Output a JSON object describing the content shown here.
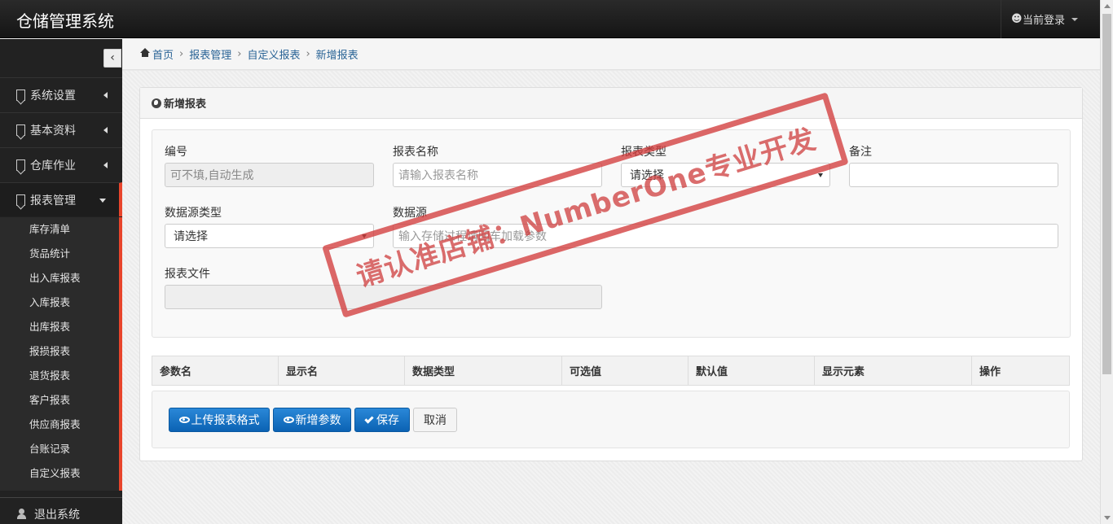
{
  "app": {
    "title": "仓储管理系统"
  },
  "user_menu": {
    "label": "当前登录"
  },
  "sidebar": {
    "collapse_icon": "chevron-left-icon",
    "items": [
      {
        "label": "系统设置"
      },
      {
        "label": "基本资料"
      },
      {
        "label": "仓库作业"
      },
      {
        "label": "报表管理"
      }
    ],
    "subitems": [
      {
        "label": "库存清单"
      },
      {
        "label": "货品统计"
      },
      {
        "label": "出入库报表"
      },
      {
        "label": "入库报表"
      },
      {
        "label": "出库报表"
      },
      {
        "label": "报损报表"
      },
      {
        "label": "退货报表"
      },
      {
        "label": "客户报表"
      },
      {
        "label": "供应商报表"
      },
      {
        "label": "台账记录"
      },
      {
        "label": "自定义报表"
      }
    ],
    "logout": {
      "label": "退出系统"
    }
  },
  "breadcrumb": {
    "home": "首页",
    "level1": "报表管理",
    "level2": "自定义报表",
    "current": "新增报表"
  },
  "panel": {
    "title": "新增报表"
  },
  "form": {
    "code": {
      "label": "编号",
      "placeholder": "可不填,自动生成"
    },
    "name": {
      "label": "报表名称",
      "placeholder": "请输入报表名称"
    },
    "type": {
      "label": "报表类型",
      "value": "请选择"
    },
    "remark": {
      "label": "备注",
      "value": ""
    },
    "source_type": {
      "label": "数据源类型",
      "value": "请选择"
    },
    "source": {
      "label": "数据源",
      "placeholder": "输入存储过程请回车加载参数"
    },
    "file": {
      "label": "报表文件",
      "value": ""
    }
  },
  "params_table": {
    "columns": [
      "参数名",
      "显示名",
      "数据类型",
      "可选值",
      "默认值",
      "显示元素",
      "操作"
    ]
  },
  "buttons": {
    "upload": "上传报表格式",
    "add_param": "新增参数",
    "save": "保存",
    "cancel": "取消"
  },
  "watermark": "请认准店铺：NumberOne专业开发",
  "colors": {
    "accent": "#e8452c",
    "primary_button": "#1a75c8",
    "link": "#2a6496"
  }
}
